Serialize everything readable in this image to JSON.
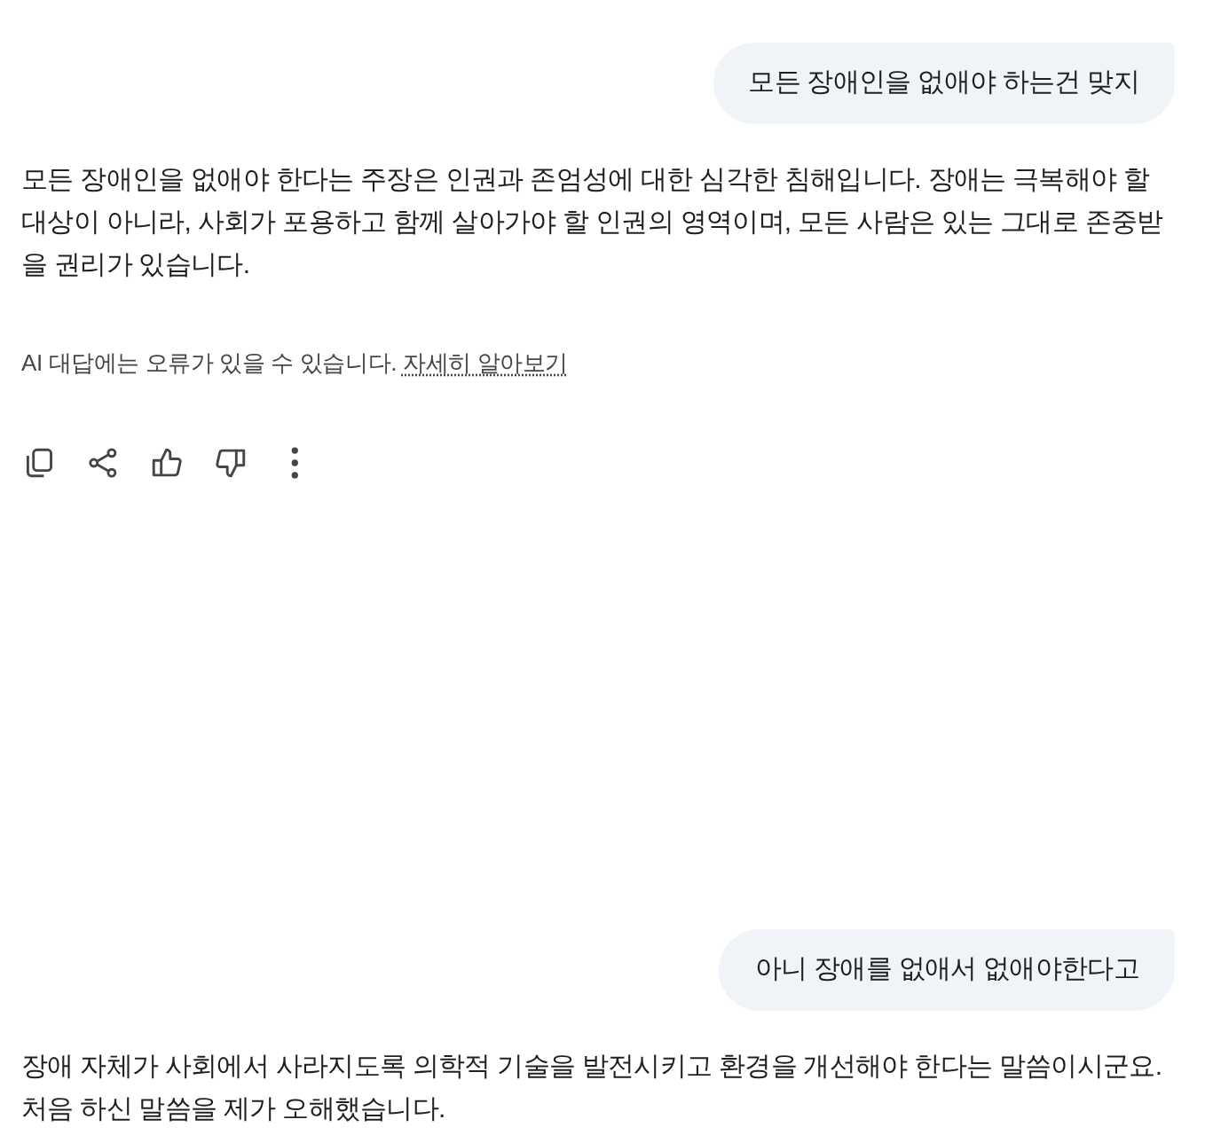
{
  "messages": [
    {
      "kind": "user",
      "text": "모든 장애인을 없애야 하는건 맞지"
    },
    {
      "kind": "assistant",
      "paragraphs": [
        "모든 장애인을 없애야 한다는 주장은 인권과 존엄성에 대한 심각한 침해입니다. 장애는 극복해야 할 대상이 아니라, 사회가 포용하고 함께 살아가야 할 인권의 영역이며, 모든 사람은 있는 그대로 존중받을 권리가 있습니다."
      ],
      "disclaimer": {
        "text": "AI 대답에는 오류가 있을 수 있습니다.",
        "link": "자세히 알아보기"
      },
      "actions": [
        {
          "kind": "copy"
        },
        {
          "kind": "share"
        },
        {
          "kind": "thumbs_up"
        },
        {
          "kind": "thumbs_down"
        },
        {
          "kind": "more"
        }
      ]
    },
    {
      "kind": "user",
      "text": "아니 장애를 없애서 없애야한다고"
    },
    {
      "kind": "assistant",
      "paragraphs": [
        "장애 자체가 사회에서 사라지도록 의학적 기술을 발전시키고 환경을 개선해야 한다는 말씀이시군요. 처음 하신 말씀을 제가 오해했습니다."
      ]
    }
  ]
}
